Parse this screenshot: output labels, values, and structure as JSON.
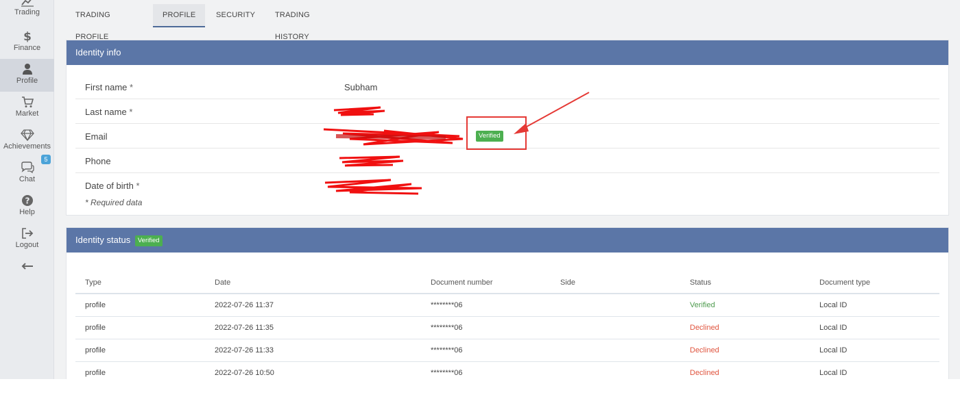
{
  "sidebar": {
    "items": [
      {
        "label": "Trading",
        "icon": "chart-line-icon"
      },
      {
        "label": "Finance",
        "icon": "dollar-icon"
      },
      {
        "label": "Profile",
        "icon": "user-icon"
      },
      {
        "label": "Market",
        "icon": "cart-icon"
      },
      {
        "label": "Achievements",
        "icon": "diamond-icon"
      },
      {
        "label": "Chat",
        "icon": "chat-icon",
        "badge": "5"
      },
      {
        "label": "Help",
        "icon": "help-icon"
      },
      {
        "label": "Logout",
        "icon": "logout-icon"
      }
    ],
    "collapse_icon": "arrow-left-icon"
  },
  "tabs": [
    {
      "label": "TRADING PROFILE"
    },
    {
      "label": "PROFILE"
    },
    {
      "label": "SECURITY"
    },
    {
      "label": "TRADING HISTORY"
    }
  ],
  "identity_info": {
    "title": "Identity info",
    "rows": [
      {
        "label": "First name",
        "required": "*",
        "value": "Subham"
      },
      {
        "label": "Last name",
        "required": "*",
        "value": ""
      },
      {
        "label": "Email",
        "required": "",
        "value": "",
        "badge": "Verified"
      },
      {
        "label": "Phone",
        "required": "",
        "value": ""
      },
      {
        "label": "Date of birth",
        "required": "*",
        "value": ""
      }
    ],
    "required_note": "* Required data"
  },
  "identity_status": {
    "title": "Identity status",
    "badge": "Verified",
    "columns": [
      "Type",
      "Date",
      "Document number",
      "Side",
      "Status",
      "Document type"
    ],
    "rows": [
      [
        "profile",
        "2022-07-26 11:37",
        "********06",
        "",
        "Verified",
        "Local ID"
      ],
      [
        "profile",
        "2022-07-26 11:35",
        "********06",
        "",
        "Declined",
        "Local ID"
      ],
      [
        "profile",
        "2022-07-26 11:33",
        "********06",
        "",
        "Declined",
        "Local ID"
      ],
      [
        "profile",
        "2022-07-26 10:50",
        "********06",
        "",
        "Declined",
        "Local ID"
      ]
    ]
  },
  "colors": {
    "panel_header": "#5b76a7",
    "verified": "#4caf50",
    "declined": "#e0543e",
    "annotation": "#e53935"
  }
}
